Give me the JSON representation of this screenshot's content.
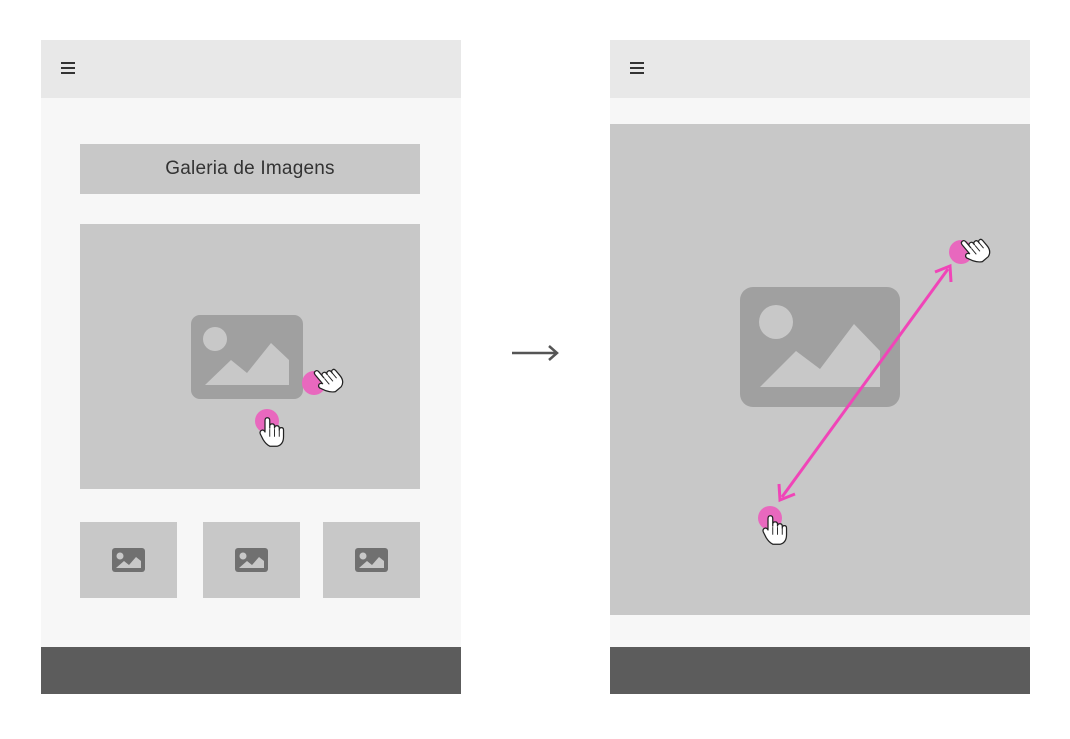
{
  "left_screen": {
    "menu_icon": "hamburger-menu-icon",
    "gallery_title": "Galeria de Imagens",
    "main_image_icon": "image-placeholder-icon",
    "thumbnails": [
      {
        "icon": "image-placeholder-icon"
      },
      {
        "icon": "image-placeholder-icon"
      },
      {
        "icon": "image-placeholder-icon"
      }
    ],
    "gesture": "pinch-zoom"
  },
  "transition_icon": "right-arrow-icon",
  "right_screen": {
    "menu_icon": "hamburger-menu-icon",
    "zoomed_image_icon": "image-placeholder-icon",
    "gesture": "pinch-expand"
  },
  "colors": {
    "touch_point": "#e868be",
    "gesture_arrow": "#f045b8",
    "placeholder_bg": "#c8c8c8",
    "placeholder_icon": "#a0a0a0",
    "thumb_icon": "#707070",
    "footer": "#5c5c5c",
    "topbar": "#e8e8e8"
  }
}
